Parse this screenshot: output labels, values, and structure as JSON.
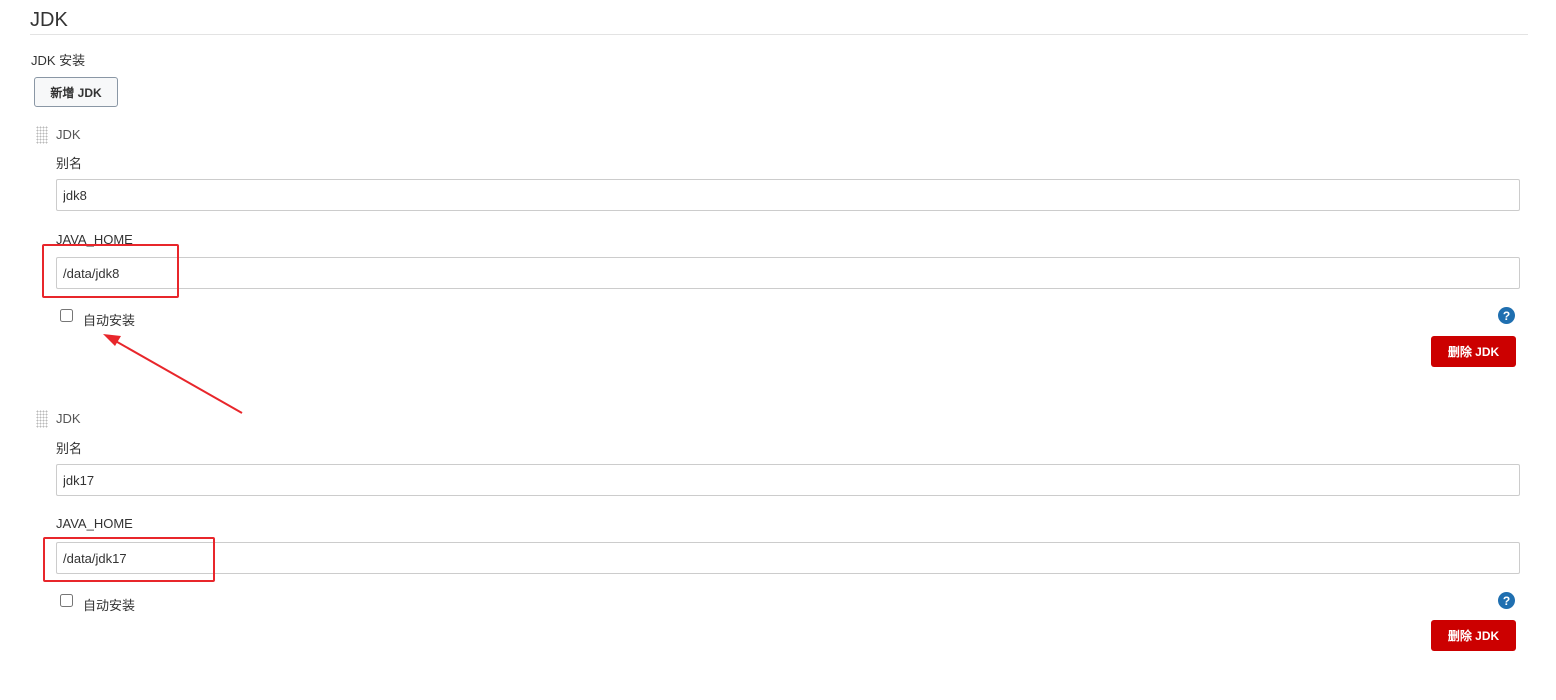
{
  "section": {
    "title": "JDK",
    "install_label": "JDK 安装",
    "add_button": "新增 JDK"
  },
  "installations": [
    {
      "title": "JDK",
      "alias_label": "别名",
      "alias_value": "jdk8",
      "home_label": "JAVA_HOME",
      "home_value": "/data/jdk8",
      "auto_install_label": "自动安装",
      "auto_install_checked": false,
      "help_icon": "?",
      "delete_button": "删除 JDK"
    },
    {
      "title": "JDK",
      "alias_label": "别名",
      "alias_value": "jdk17",
      "home_label": "JAVA_HOME",
      "home_value": "/data/jdk17",
      "auto_install_label": "自动安装",
      "auto_install_checked": false,
      "help_icon": "?",
      "delete_button": "删除 JDK"
    }
  ],
  "colors": {
    "delete_button": "#cc0000",
    "help_icon": "#1f6fb0",
    "annotation": "#e8262b"
  }
}
